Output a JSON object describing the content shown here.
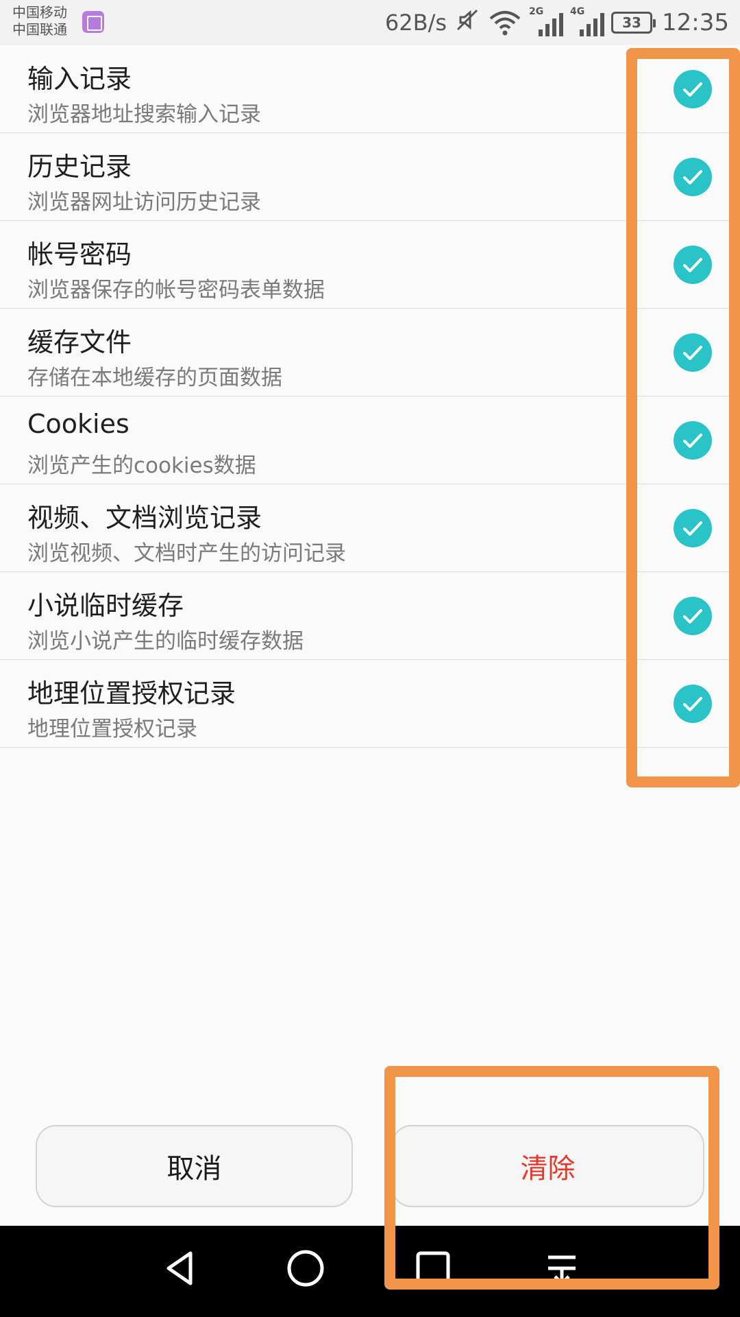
{
  "status_bar": {
    "carrier_1": "中国移动",
    "carrier_2": "中国联通",
    "net_speed": "62B/s",
    "signal_1_tag": "2G",
    "signal_2_tag": "4G",
    "battery": "33",
    "time": "12:35"
  },
  "items": [
    {
      "title": "输入记录",
      "subtitle": "浏览器地址搜索输入记录",
      "checked": true
    },
    {
      "title": "历史记录",
      "subtitle": "浏览器网址访问历史记录",
      "checked": true
    },
    {
      "title": "帐号密码",
      "subtitle": "浏览器保存的帐号密码表单数据",
      "checked": true
    },
    {
      "title": "缓存文件",
      "subtitle": "存储在本地缓存的页面数据",
      "checked": true
    },
    {
      "title": "Cookies",
      "subtitle": "浏览产生的cookies数据",
      "checked": true
    },
    {
      "title": "视频、文档浏览记录",
      "subtitle": "浏览视频、文档时产生的访问记录",
      "checked": true
    },
    {
      "title": "小说临时缓存",
      "subtitle": "浏览小说产生的临时缓存数据",
      "checked": true
    },
    {
      "title": "地理位置授权记录",
      "subtitle": "地理位置授权记录",
      "checked": true
    }
  ],
  "buttons": {
    "cancel": "取消",
    "clear": "清除"
  },
  "colors": {
    "check": "#2ac3c8",
    "clear_text": "#e8362a",
    "highlight": "#f0954a"
  }
}
